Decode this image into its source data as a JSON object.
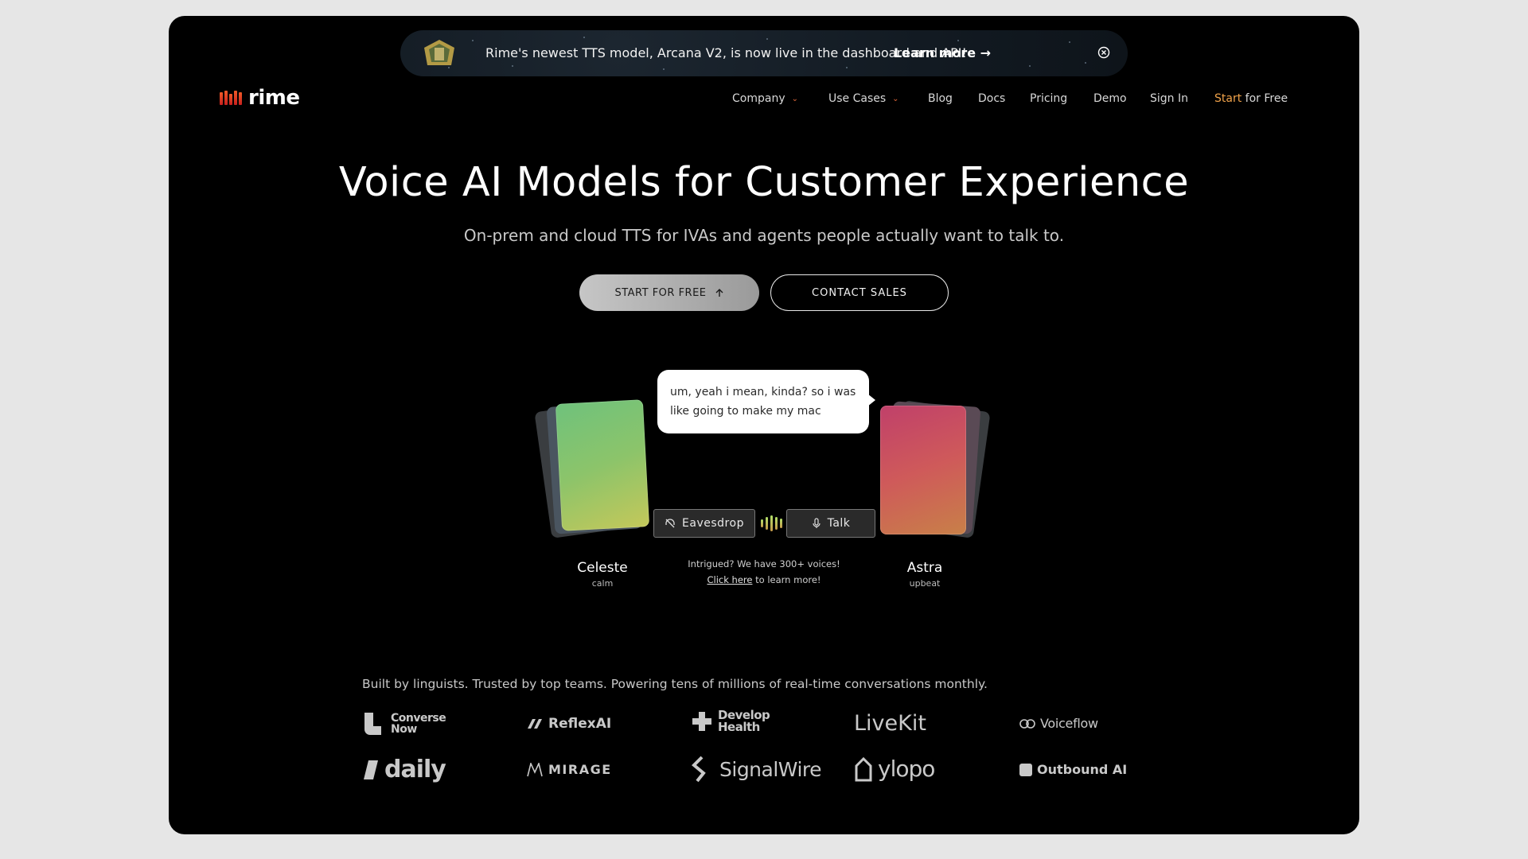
{
  "banner": {
    "message": "Rime's newest TTS model, Arcana V2, is now live in the dashboard and API!",
    "link": "Learn more →"
  },
  "brand": {
    "name": "rime"
  },
  "nav": {
    "items": [
      {
        "label": "Company"
      },
      {
        "label": "Use Cases"
      },
      {
        "label": "Blog"
      },
      {
        "label": "Docs"
      },
      {
        "label": "Pricing"
      },
      {
        "label": "Demo"
      },
      {
        "label": "Sign In"
      }
    ],
    "cta_highlight": "Start",
    "cta_rest": " for Free"
  },
  "hero": {
    "title": "Voice AI Models for Customer Experience",
    "subtitle": "On-prem and cloud TTS for IVAs and agents people actually want to talk to.",
    "primary_button": "START FOR FREE",
    "secondary_button": "CONTACT SALES"
  },
  "demo": {
    "bubble_text": "um, yeah i mean, kinda? so i was like going to make my mac",
    "left_voice": {
      "name": "Celeste",
      "mood": "calm"
    },
    "right_voice": {
      "name": "Astra",
      "mood": "upbeat"
    },
    "eavesdrop_label": "Eavesdrop",
    "talk_label": "Talk",
    "intrigued_text": "Intrigued? We have 300+ voices!",
    "click_here": "Click here",
    "learn_more": " to learn more!"
  },
  "trusted": {
    "text": "Built by linguists. Trusted by top teams. Powering tens of millions of real-time conversations monthly.",
    "logos": [
      {
        "line1": "Converse",
        "line2": "Now"
      },
      {
        "name": "ReflexAI"
      },
      {
        "line1": "Develop",
        "line2": "Health"
      },
      {
        "name": "LiveKit"
      },
      {
        "name": "Voiceflow"
      },
      {
        "name": "daily"
      },
      {
        "name": "MIRAGE"
      },
      {
        "name": "SignalWire"
      },
      {
        "name": "ylopo"
      },
      {
        "name": "Outbound AI"
      }
    ]
  },
  "colors": {
    "accent_orange": "#f0a24a",
    "logo_red": "#e0402a",
    "background": "#000000"
  }
}
